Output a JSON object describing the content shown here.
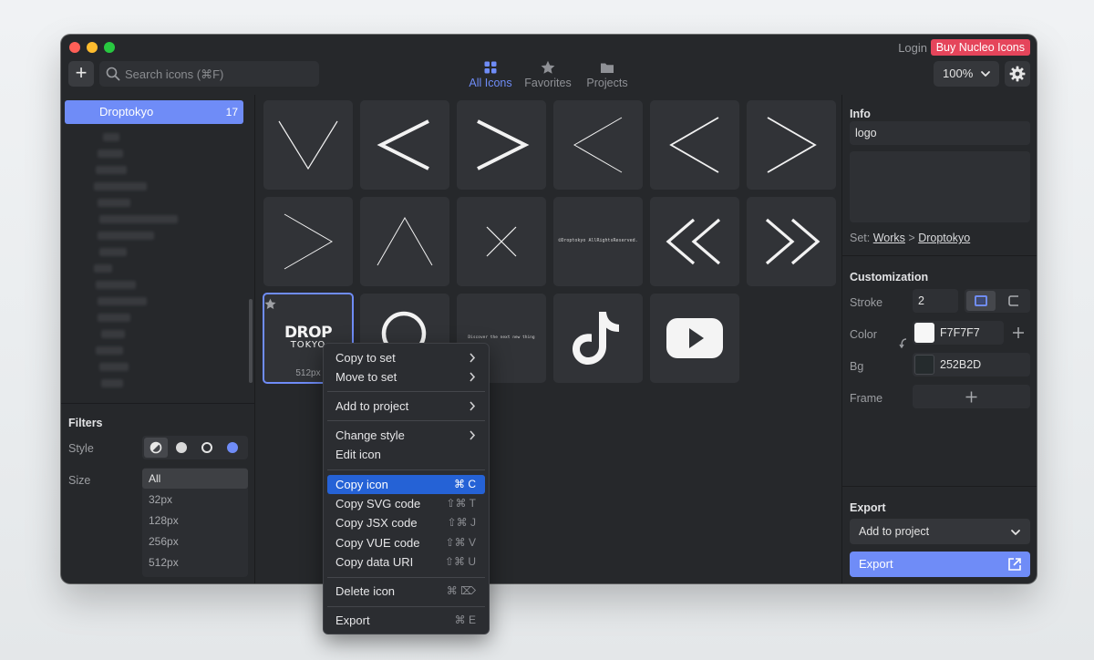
{
  "titlebar": {
    "login": "Login",
    "buy": "Buy Nucleo Icons"
  },
  "toolbar": {
    "add_label": "+",
    "search_placeholder": "Search icons (⌘F)",
    "tabs": [
      {
        "label": "All Icons",
        "icon": "grid-icon",
        "active": true
      },
      {
        "label": "Favorites",
        "icon": "star-icon",
        "active": false
      },
      {
        "label": "Projects",
        "icon": "folder-icon",
        "active": false
      }
    ],
    "zoom": "100%"
  },
  "sidebar": {
    "selected_set": {
      "label": "Droptokyo",
      "count": "17"
    },
    "filters": {
      "heading": "Filters",
      "style_label": "Style",
      "size_label": "Size",
      "sizes": [
        "All",
        "32px",
        "128px",
        "256px",
        "512px"
      ],
      "selected_size": "All"
    }
  },
  "grid": {
    "tiles": [
      {
        "icon": "chevron-down-thin-icon"
      },
      {
        "icon": "chevron-left-bold-icon"
      },
      {
        "icon": "chevron-right-bold-icon"
      },
      {
        "icon": "chevron-left-thin-icon"
      },
      {
        "icon": "chevron-left-medium-icon"
      },
      {
        "icon": "chevron-right-medium-icon"
      },
      {
        "icon": "chevron-right-thin-icon"
      },
      {
        "icon": "chevron-up-thin-icon"
      },
      {
        "icon": "close-thin-icon"
      },
      {
        "icon": "copyright-text-icon",
        "text": "©Droptokyo AllRightsReserved."
      },
      {
        "icon": "double-chevron-left-icon"
      },
      {
        "icon": "double-chevron-right-icon"
      },
      {
        "icon": "drop-tokyo-logo-icon",
        "logo_line1": "DROP",
        "logo_line2": "TOKYO",
        "size": "512px",
        "selected": true
      },
      {
        "icon": "circle-icon"
      },
      {
        "icon": "discover-text-icon",
        "text": "Discover the next new thing"
      },
      {
        "icon": "tiktok-icon"
      },
      {
        "icon": "youtube-icon"
      }
    ]
  },
  "info": {
    "heading": "Info",
    "name_value": "logo",
    "set_prefix": "Set:",
    "set_path": [
      "Works",
      "Droptokyo"
    ],
    "separator": ">"
  },
  "customization": {
    "heading": "Customization",
    "stroke_label": "Stroke",
    "stroke_value": "2",
    "color_label": "Color",
    "color_value": "F7F7F7",
    "bg_label": "Bg",
    "bg_value": "252B2D",
    "frame_label": "Frame",
    "colors": {
      "icon": "#F7F7F7",
      "bg": "#252B2D"
    }
  },
  "export": {
    "heading": "Export",
    "add_to_project": "Add to project",
    "export_label": "Export"
  },
  "context_menu": {
    "items": [
      {
        "label": "Copy to set",
        "submenu": true
      },
      {
        "label": "Move to set",
        "submenu": true
      },
      {
        "label": "Add to project",
        "submenu": true
      },
      {
        "label": "Change style",
        "submenu": true
      },
      {
        "label": "Edit icon"
      },
      {
        "label": "Copy icon",
        "shortcut": "⌘ C",
        "highlighted": true
      },
      {
        "label": "Copy SVG code",
        "shortcut": "⇧⌘ T"
      },
      {
        "label": "Copy JSX code",
        "shortcut": "⇧⌘ J"
      },
      {
        "label": "Copy VUE code",
        "shortcut": "⇧⌘ V"
      },
      {
        "label": "Copy data URI",
        "shortcut": "⇧⌘ U"
      },
      {
        "label": "Delete icon",
        "shortcut": "⌘ ⌦"
      },
      {
        "label": "Export",
        "shortcut": "⌘ E"
      }
    ]
  },
  "accent": "#6F8CF7",
  "highlight": "#2562D6",
  "buy_color": "#E5455B"
}
